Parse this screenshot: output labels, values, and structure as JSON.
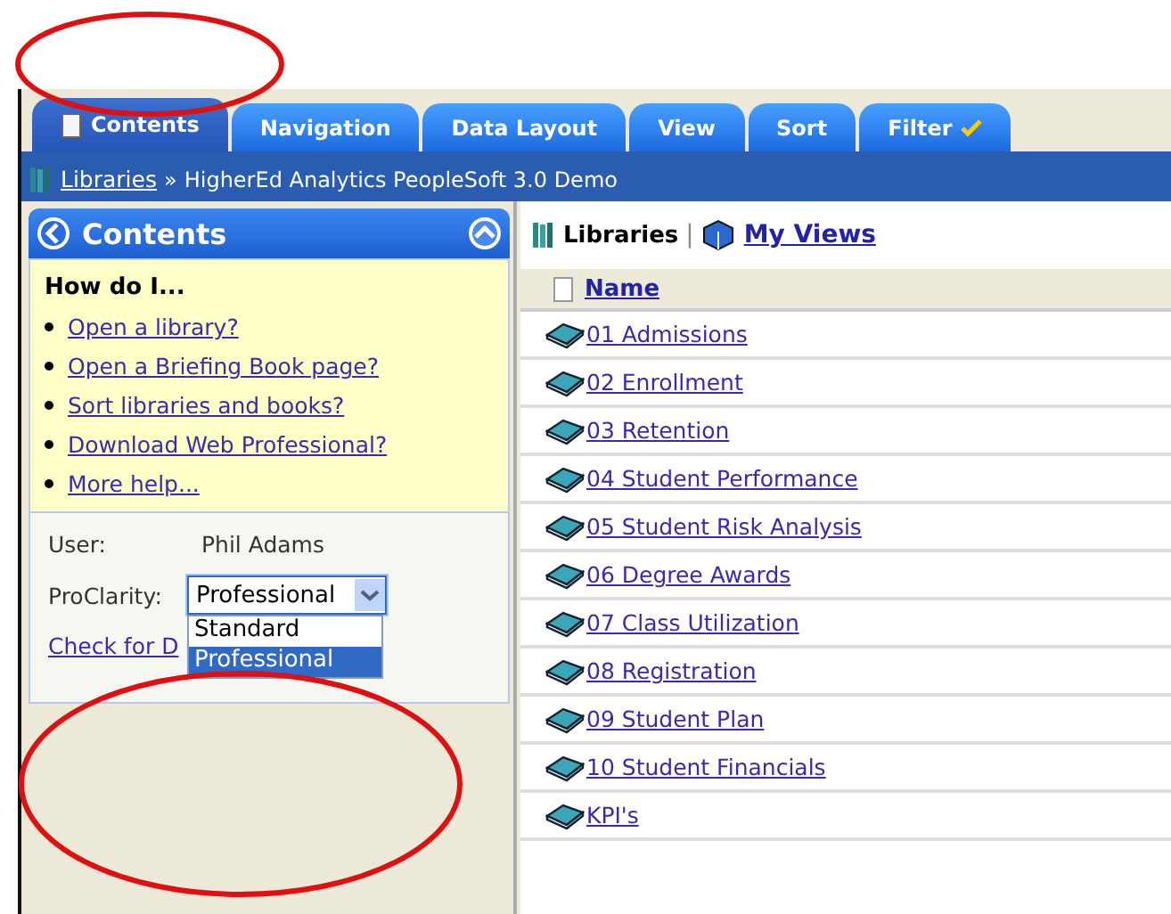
{
  "tabs": [
    {
      "label": "Contents",
      "selected": true,
      "kind": "doc"
    },
    {
      "label": "Navigation",
      "selected": false,
      "kind": "plain"
    },
    {
      "label": "Data Layout",
      "selected": false,
      "kind": "plain"
    },
    {
      "label": "View",
      "selected": false,
      "kind": "plain"
    },
    {
      "label": "Sort",
      "selected": false,
      "kind": "plain"
    },
    {
      "label": "Filter",
      "selected": false,
      "kind": "check"
    }
  ],
  "breadcrumb": {
    "link": "Libraries",
    "separator": "»",
    "current": "HigherEd Analytics PeopleSoft 3.0 Demo"
  },
  "sidebar": {
    "title": "Contents",
    "help_title": "How do I...",
    "help_links": [
      "Open a library?",
      "Open a Briefing Book page?",
      "Sort libraries and books?",
      "Download Web Professional?",
      "More help..."
    ],
    "user_label": "User:",
    "user_value": "Phil Adams",
    "proclarity_label": "ProClarity:",
    "dropdown": {
      "value": "Professional",
      "expanded": true,
      "options": [
        {
          "label": "Standard",
          "selected": false
        },
        {
          "label": "Professional",
          "selected": true
        }
      ]
    },
    "check_link": "Check for D"
  },
  "main": {
    "libraries_label": "Libraries",
    "separator": "|",
    "my_views": "My Views",
    "column": "Name",
    "rows": [
      "01 Admissions",
      "02 Enrollment",
      "03 Retention",
      "04 Student Performance",
      "05 Student Risk Analysis",
      "06 Degree Awards",
      "07 Class Utilization",
      "08 Registration",
      "09 Student Plan",
      "10 Student Financials",
      "KPI's"
    ]
  }
}
